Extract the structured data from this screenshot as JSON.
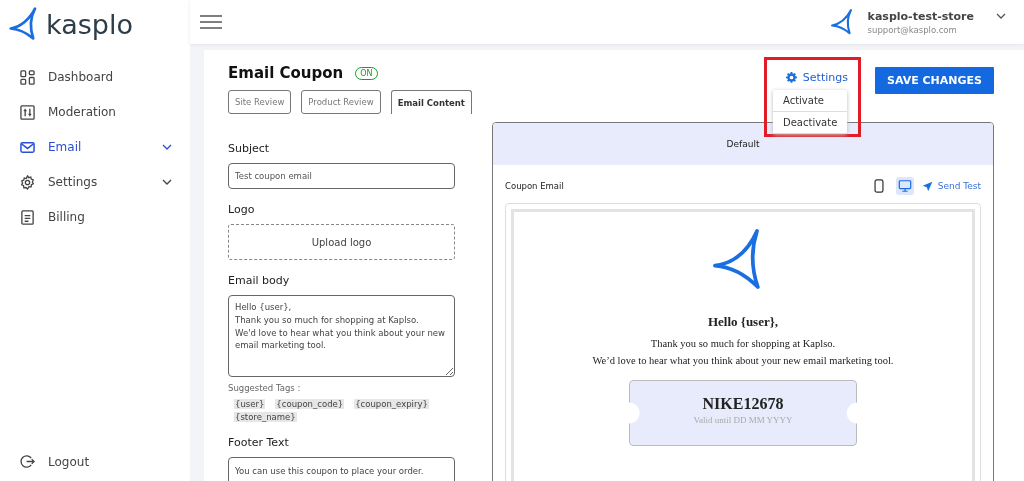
{
  "brand": {
    "name": "kasplo"
  },
  "nav": [
    {
      "label": "Dashboard",
      "kind": "dashboard",
      "selected": false,
      "expandable": false
    },
    {
      "label": "Moderation",
      "kind": "moderation",
      "selected": false,
      "expandable": false
    },
    {
      "label": "Email",
      "kind": "email",
      "selected": true,
      "expandable": true
    },
    {
      "label": "Settings",
      "kind": "settings",
      "selected": false,
      "expandable": true
    },
    {
      "label": "Billing",
      "kind": "billing",
      "selected": false,
      "expandable": false
    }
  ],
  "logout": {
    "label": "Logout"
  },
  "account": {
    "store": "kasplo-test-store",
    "email": "support@kasplo.com"
  },
  "page": {
    "title": "Email Coupon",
    "status": {
      "label": "ON",
      "on": true
    }
  },
  "tabs": [
    {
      "label": "Site Review",
      "selected": false
    },
    {
      "label": "Product Review",
      "selected": false
    },
    {
      "label": "Email Content",
      "selected": true
    }
  ],
  "settings_menu": {
    "label": "Settings",
    "expanded": true,
    "items": [
      "Activate",
      "Deactivate"
    ]
  },
  "save_button": "SAVE CHANGES",
  "form": {
    "subject": {
      "label": "Subject",
      "value": "Test coupon email"
    },
    "logo": {
      "label": "Logo",
      "button": "Upload logo"
    },
    "body": {
      "label": "Email body",
      "value": "Hello {user},\nThank you so much for shopping at Kaplso.\nWe'd love to hear what you think about your new email marketing tool."
    },
    "tags_label": "Suggested Tags :",
    "tags": [
      "{user}",
      "{coupon_code}",
      "{coupon_expiry}",
      "{store_name}"
    ],
    "footer": {
      "label": "Footer Text",
      "value": "You can use this coupon to place your order."
    }
  },
  "preview": {
    "header": "Default",
    "title": "Coupon Email",
    "devices": [
      {
        "kind": "mobile",
        "selected": false
      },
      {
        "kind": "desktop",
        "selected": true
      }
    ],
    "send_test": "Send Test",
    "email": {
      "greeting": "Hello {user},",
      "lines": [
        "Thank you so much for shopping at Kaplso.",
        "We’d love to hear what you think about your new email marketing tool."
      ],
      "coupon_code": "NIKE12678",
      "validity": "Valid until DD MM YYYY"
    }
  }
}
